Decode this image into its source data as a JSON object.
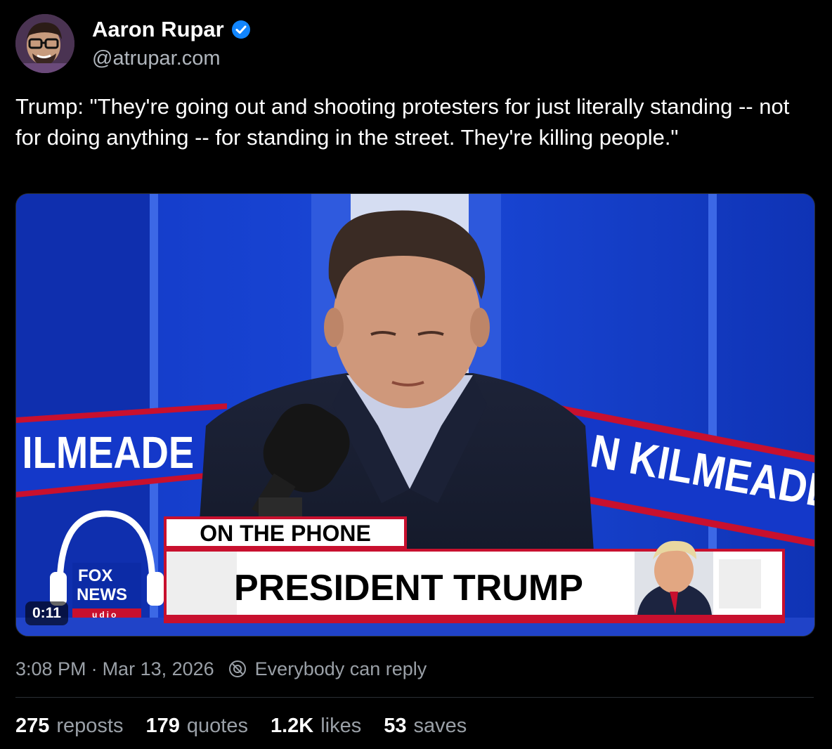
{
  "author": {
    "display_name": "Aaron Rupar",
    "handle": "@atrupar.com",
    "verified": true
  },
  "post": {
    "text": "Trump: \"They're going out and shooting protesters for just literally standing -- not for doing anything -- for standing in the street. They're killing people.\""
  },
  "media": {
    "type": "video",
    "duration": "0:11",
    "video_text": {
      "banner_top": "ON THE PHONE",
      "banner_main": "PRESIDENT TRUMP",
      "wall_left": "ILMEADE S",
      "wall_right": "AN KILMEADE",
      "logo_line1": "FOX",
      "logo_line2": "NEWS",
      "logo_line3": "udio"
    }
  },
  "meta": {
    "time": "3:08 PM",
    "separator": "·",
    "date": "Mar 13, 2026",
    "reply_setting": "Everybody can reply"
  },
  "stats": [
    {
      "count": "275",
      "label": "reposts"
    },
    {
      "count": "179",
      "label": "quotes"
    },
    {
      "count": "1.2K",
      "label": "likes"
    },
    {
      "count": "53",
      "label": "saves"
    }
  ],
  "colors": {
    "background": "#000000",
    "verified_badge": "#1185fe",
    "secondary_text": "#9aa0a7",
    "fox_red": "#c8102e",
    "studio_blue": "#1340c8"
  }
}
